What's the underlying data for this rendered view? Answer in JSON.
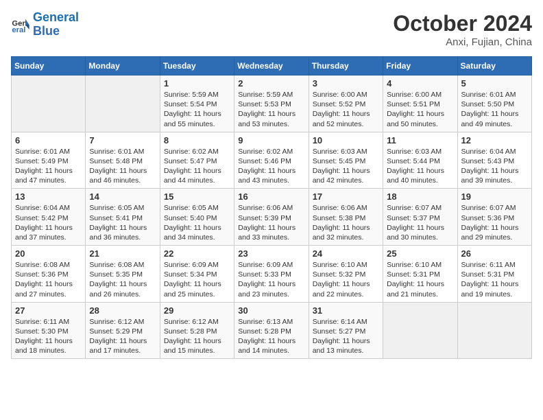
{
  "header": {
    "logo_line1": "General",
    "logo_line2": "Blue",
    "month": "October 2024",
    "location": "Anxi, Fujian, China"
  },
  "weekdays": [
    "Sunday",
    "Monday",
    "Tuesday",
    "Wednesday",
    "Thursday",
    "Friday",
    "Saturday"
  ],
  "weeks": [
    [
      {
        "day": "",
        "info": ""
      },
      {
        "day": "",
        "info": ""
      },
      {
        "day": "1",
        "info": "Sunrise: 5:59 AM\nSunset: 5:54 PM\nDaylight: 11 hours and 55 minutes."
      },
      {
        "day": "2",
        "info": "Sunrise: 5:59 AM\nSunset: 5:53 PM\nDaylight: 11 hours and 53 minutes."
      },
      {
        "day": "3",
        "info": "Sunrise: 6:00 AM\nSunset: 5:52 PM\nDaylight: 11 hours and 52 minutes."
      },
      {
        "day": "4",
        "info": "Sunrise: 6:00 AM\nSunset: 5:51 PM\nDaylight: 11 hours and 50 minutes."
      },
      {
        "day": "5",
        "info": "Sunrise: 6:01 AM\nSunset: 5:50 PM\nDaylight: 11 hours and 49 minutes."
      }
    ],
    [
      {
        "day": "6",
        "info": "Sunrise: 6:01 AM\nSunset: 5:49 PM\nDaylight: 11 hours and 47 minutes."
      },
      {
        "day": "7",
        "info": "Sunrise: 6:01 AM\nSunset: 5:48 PM\nDaylight: 11 hours and 46 minutes."
      },
      {
        "day": "8",
        "info": "Sunrise: 6:02 AM\nSunset: 5:47 PM\nDaylight: 11 hours and 44 minutes."
      },
      {
        "day": "9",
        "info": "Sunrise: 6:02 AM\nSunset: 5:46 PM\nDaylight: 11 hours and 43 minutes."
      },
      {
        "day": "10",
        "info": "Sunrise: 6:03 AM\nSunset: 5:45 PM\nDaylight: 11 hours and 42 minutes."
      },
      {
        "day": "11",
        "info": "Sunrise: 6:03 AM\nSunset: 5:44 PM\nDaylight: 11 hours and 40 minutes."
      },
      {
        "day": "12",
        "info": "Sunrise: 6:04 AM\nSunset: 5:43 PM\nDaylight: 11 hours and 39 minutes."
      }
    ],
    [
      {
        "day": "13",
        "info": "Sunrise: 6:04 AM\nSunset: 5:42 PM\nDaylight: 11 hours and 37 minutes."
      },
      {
        "day": "14",
        "info": "Sunrise: 6:05 AM\nSunset: 5:41 PM\nDaylight: 11 hours and 36 minutes."
      },
      {
        "day": "15",
        "info": "Sunrise: 6:05 AM\nSunset: 5:40 PM\nDaylight: 11 hours and 34 minutes."
      },
      {
        "day": "16",
        "info": "Sunrise: 6:06 AM\nSunset: 5:39 PM\nDaylight: 11 hours and 33 minutes."
      },
      {
        "day": "17",
        "info": "Sunrise: 6:06 AM\nSunset: 5:38 PM\nDaylight: 11 hours and 32 minutes."
      },
      {
        "day": "18",
        "info": "Sunrise: 6:07 AM\nSunset: 5:37 PM\nDaylight: 11 hours and 30 minutes."
      },
      {
        "day": "19",
        "info": "Sunrise: 6:07 AM\nSunset: 5:36 PM\nDaylight: 11 hours and 29 minutes."
      }
    ],
    [
      {
        "day": "20",
        "info": "Sunrise: 6:08 AM\nSunset: 5:36 PM\nDaylight: 11 hours and 27 minutes."
      },
      {
        "day": "21",
        "info": "Sunrise: 6:08 AM\nSunset: 5:35 PM\nDaylight: 11 hours and 26 minutes."
      },
      {
        "day": "22",
        "info": "Sunrise: 6:09 AM\nSunset: 5:34 PM\nDaylight: 11 hours and 25 minutes."
      },
      {
        "day": "23",
        "info": "Sunrise: 6:09 AM\nSunset: 5:33 PM\nDaylight: 11 hours and 23 minutes."
      },
      {
        "day": "24",
        "info": "Sunrise: 6:10 AM\nSunset: 5:32 PM\nDaylight: 11 hours and 22 minutes."
      },
      {
        "day": "25",
        "info": "Sunrise: 6:10 AM\nSunset: 5:31 PM\nDaylight: 11 hours and 21 minutes."
      },
      {
        "day": "26",
        "info": "Sunrise: 6:11 AM\nSunset: 5:31 PM\nDaylight: 11 hours and 19 minutes."
      }
    ],
    [
      {
        "day": "27",
        "info": "Sunrise: 6:11 AM\nSunset: 5:30 PM\nDaylight: 11 hours and 18 minutes."
      },
      {
        "day": "28",
        "info": "Sunrise: 6:12 AM\nSunset: 5:29 PM\nDaylight: 11 hours and 17 minutes."
      },
      {
        "day": "29",
        "info": "Sunrise: 6:12 AM\nSunset: 5:28 PM\nDaylight: 11 hours and 15 minutes."
      },
      {
        "day": "30",
        "info": "Sunrise: 6:13 AM\nSunset: 5:28 PM\nDaylight: 11 hours and 14 minutes."
      },
      {
        "day": "31",
        "info": "Sunrise: 6:14 AM\nSunset: 5:27 PM\nDaylight: 11 hours and 13 minutes."
      },
      {
        "day": "",
        "info": ""
      },
      {
        "day": "",
        "info": ""
      }
    ]
  ]
}
